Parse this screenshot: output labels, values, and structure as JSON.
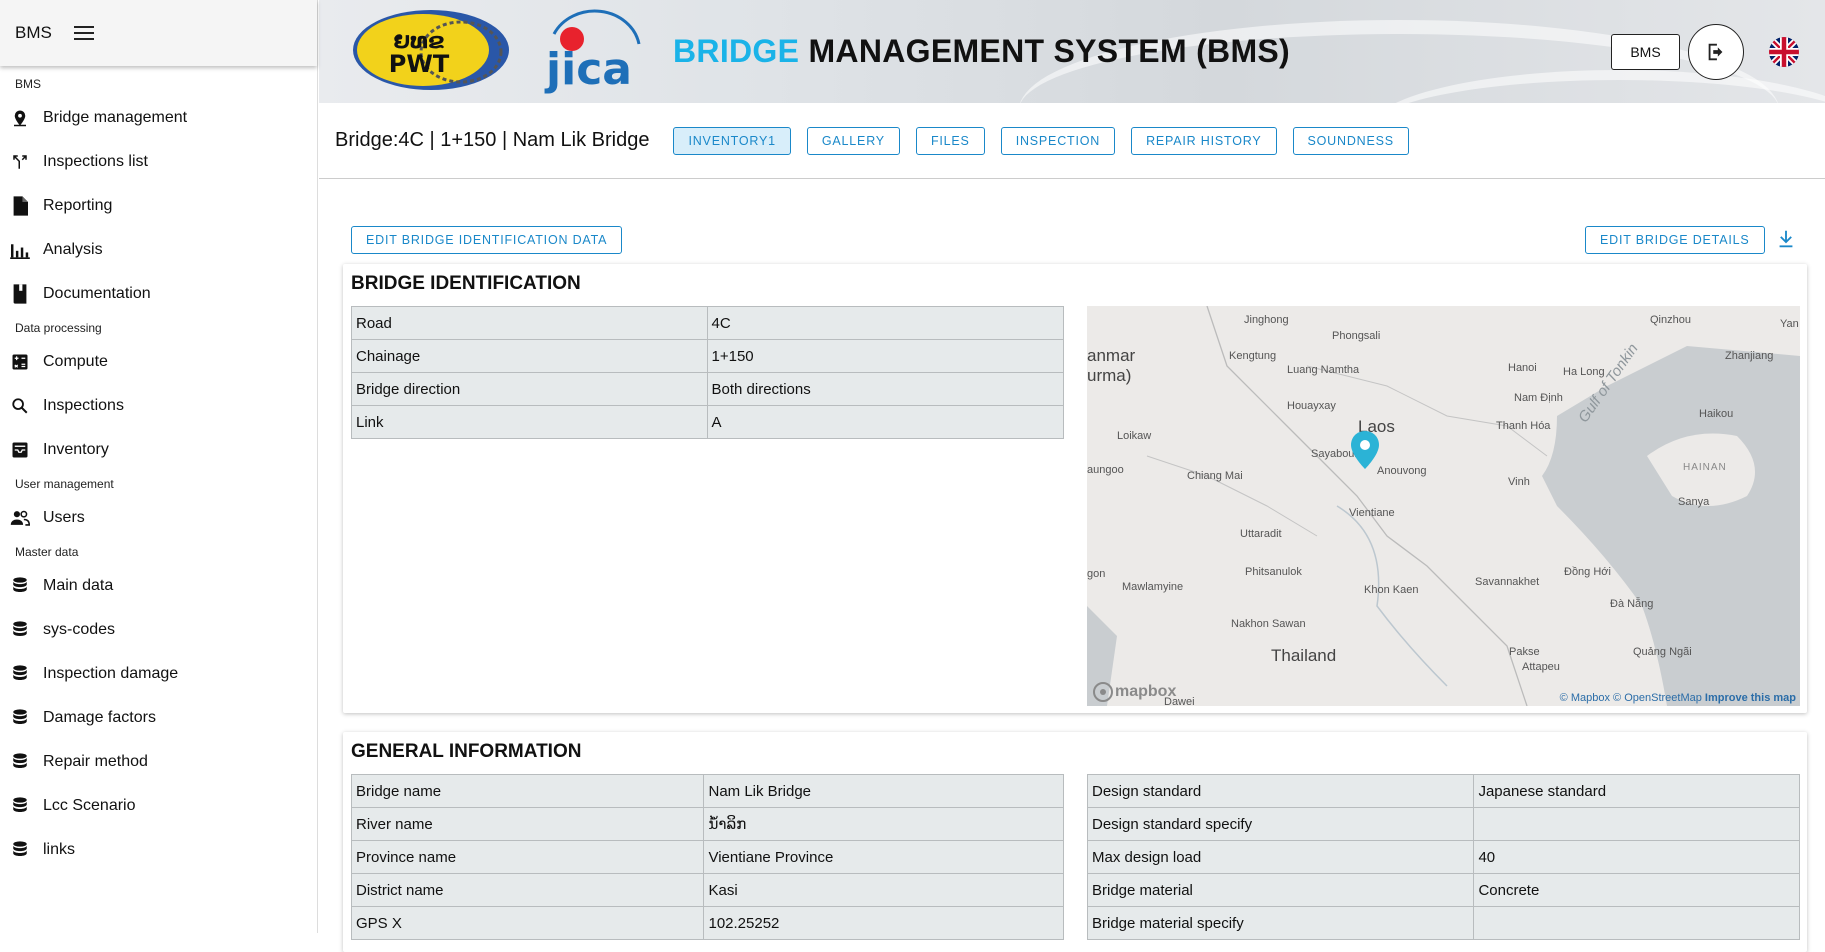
{
  "sidebar": {
    "brand": "BMS",
    "sections": [
      {
        "title": "BMS",
        "items": [
          {
            "label": "Bridge management",
            "icon": "map-pin-icon"
          },
          {
            "label": "Inspections list",
            "icon": "merge-icon"
          },
          {
            "label": "Reporting",
            "icon": "document-icon"
          },
          {
            "label": "Analysis",
            "icon": "bar-chart-icon"
          },
          {
            "label": "Documentation",
            "icon": "book-icon"
          }
        ]
      },
      {
        "title": "Data processing",
        "items": [
          {
            "label": "Compute",
            "icon": "calculator-icon"
          },
          {
            "label": "Inspections",
            "icon": "search-icon"
          },
          {
            "label": "Inventory",
            "icon": "inbox-icon"
          }
        ]
      },
      {
        "title": "User management",
        "items": [
          {
            "label": "Users",
            "icon": "users-icon"
          }
        ]
      },
      {
        "title": "Master data",
        "items": [
          {
            "label": "Main data",
            "icon": "database-icon"
          },
          {
            "label": "sys-codes",
            "icon": "database-icon"
          },
          {
            "label": "Inspection damage",
            "icon": "database-icon"
          },
          {
            "label": "Damage factors",
            "icon": "database-icon"
          },
          {
            "label": "Repair method",
            "icon": "database-icon"
          },
          {
            "label": "Lcc Scenario",
            "icon": "database-icon"
          },
          {
            "label": "links",
            "icon": "database-icon"
          }
        ]
      }
    ]
  },
  "header": {
    "title_accent": "BRIDGE",
    "title_rest": " MANAGEMENT SYSTEM (BMS)",
    "logo_left_text": "ຍທຂ PWT",
    "logo_right_text": "jica",
    "bms_button": "BMS",
    "colors": {
      "accent": "#1ab3e8"
    }
  },
  "bridge": {
    "title": "Bridge:4C | 1+150 | Nam Lik Bridge",
    "tabs": [
      "INVENTORY1",
      "GALLERY",
      "FILES",
      "INSPECTION",
      "REPAIR HISTORY",
      "SOUNDNESS"
    ],
    "active_tab": "INVENTORY1"
  },
  "actions": {
    "edit_identification": "EDIT BRIDGE IDENTIFICATION DATA",
    "edit_details": "EDIT BRIDGE DETAILS"
  },
  "identification": {
    "title": "BRIDGE IDENTIFICATION",
    "rows": [
      [
        "Road",
        "4C"
      ],
      [
        "Chainage",
        "1+150"
      ],
      [
        "Bridge direction",
        "Both directions"
      ],
      [
        "Link",
        "A"
      ]
    ]
  },
  "map": {
    "labels": {
      "myanmar": "anmar",
      "burma": "urma)",
      "laos": "Laos",
      "thailand": "Thailand",
      "gulf": "Gulf of Tonkin",
      "hainan": "HAINAN",
      "jinghong": "Jinghong",
      "phongsali": "Phongsali",
      "qinzhou": "Qinzhou",
      "yan": "Yan",
      "zhanjiang": "Zhanjiang",
      "kengtung": "Kengtung",
      "luangnamtha": "Luang Namtha",
      "hanoi": "Hanoi",
      "halong": "Ha Long",
      "namdinh": "Nam Định",
      "houayxay": "Houayxay",
      "thanhhoa": "Thanh Hóa",
      "haikou": "Haikou",
      "loikaw": "Loikaw",
      "sayabouri": "Sayabouri",
      "anouvong": "Anouvong",
      "aungoo": "aungoo",
      "chiangmai": "Chiang Mai",
      "vinh": "Vinh",
      "sanya": "Sanya",
      "vientiane": "Vientiane",
      "uttaradit": "Uttaradit",
      "phitsanulok": "Phitsanulok",
      "savannakhet": "Savannakhet",
      "donghoi": "Đồng Hới",
      "agon": "gon",
      "mawlamyine": "Mawlamyine",
      "khonkaen": "Khon Kaen",
      "danang": "Đà Nẵng",
      "nakhonsawan": "Nakhon Sawan",
      "pakse": "Pakse",
      "quangngai": "Quảng Ngãi",
      "attapeu": "Attapeu",
      "dawei": "Dawei"
    },
    "mapbox_logo": "mapbox",
    "attribution_mapbox": "© Mapbox",
    "attribution_osm": "© OpenStreetMap",
    "attribution_improve": "Improve this map",
    "marker_color": "#2bb3d6"
  },
  "general": {
    "title": "GENERAL INFORMATION",
    "left_rows": [
      [
        "Bridge name",
        "Nam Lik Bridge"
      ],
      [
        "River name",
        "ນ້ຳລິກ"
      ],
      [
        "Province name",
        "Vientiane Province"
      ],
      [
        "District name",
        "Kasi"
      ],
      [
        "GPS X",
        "102.25252"
      ]
    ],
    "right_rows": [
      [
        "Design standard",
        "Japanese standard"
      ],
      [
        "Design standard specify",
        ""
      ],
      [
        "Max design load",
        "40"
      ],
      [
        "Bridge material",
        "Concrete"
      ],
      [
        "Bridge material specify",
        ""
      ]
    ]
  }
}
